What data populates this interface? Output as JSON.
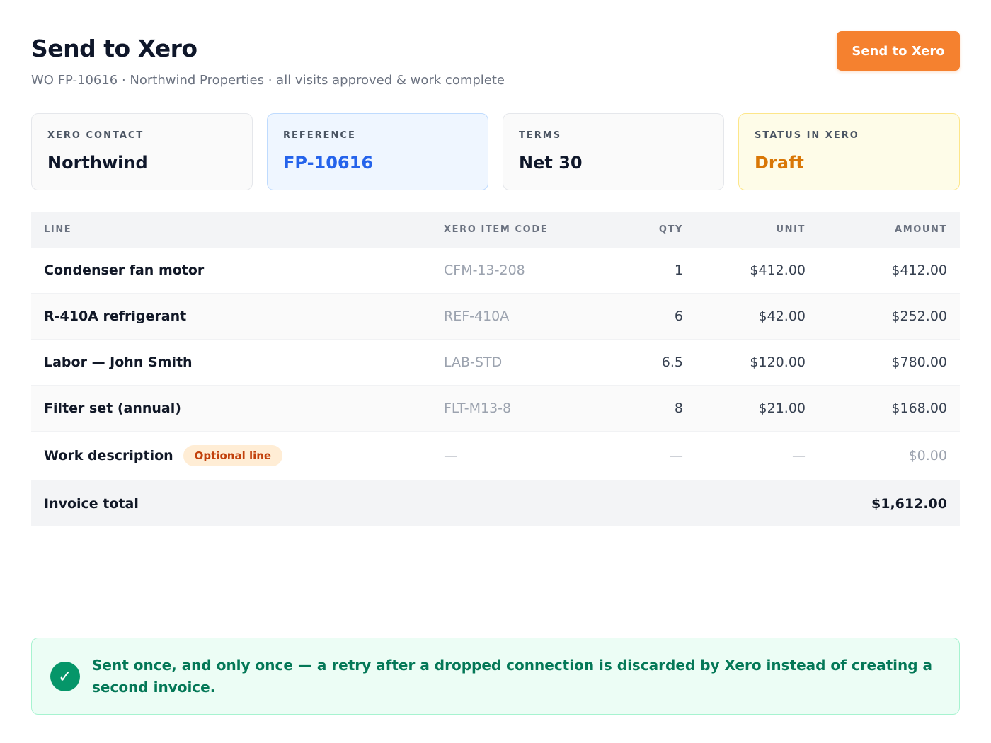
{
  "header": {
    "title": "Send to Xero",
    "subtitle": "WO FP-10616 · Northwind Properties · all visits approved & work complete",
    "send_label": "Send to Xero"
  },
  "cards": {
    "contact": {
      "label": "XERO CONTACT",
      "value": "Northwind"
    },
    "reference": {
      "label": "REFERENCE",
      "value": "FP-10616"
    },
    "terms": {
      "label": "TERMS",
      "value": "Net 30"
    },
    "status": {
      "label": "STATUS IN XERO",
      "value": "Draft"
    }
  },
  "table": {
    "headers": {
      "line": "LINE",
      "code": "XERO ITEM CODE",
      "qty": "QTY",
      "unit": "UNIT",
      "amount": "AMOUNT"
    },
    "rows": [
      {
        "line": "Condenser fan motor",
        "code": "CFM-13-208",
        "qty": "1",
        "unit": "$412.00",
        "amount": "$412.00"
      },
      {
        "line": "R-410A refrigerant",
        "code": "REF-410A",
        "qty": "6",
        "unit": "$42.00",
        "amount": "$252.00"
      },
      {
        "line": "Labor — John Smith",
        "code": "LAB-STD",
        "qty": "6.5",
        "unit": "$120.00",
        "amount": "$780.00"
      },
      {
        "line": "Filter set (annual)",
        "code": "FLT-M13-8",
        "qty": "8",
        "unit": "$21.00",
        "amount": "$168.00"
      },
      {
        "line": "Work description",
        "badge": "Optional line",
        "code": "—",
        "qty": "—",
        "unit": "—",
        "amount": "$0.00"
      }
    ],
    "total_label": "Invoice total",
    "total_value": "$1,612.00"
  },
  "notice": {
    "icon": "check-icon",
    "text": "Sent once, and only once — a retry after a dropped connection is discarded by Xero instead of creating a second invoice.",
    "color": "#059669"
  },
  "colors": {
    "accent": "#f5812f",
    "reference": "#2563eb",
    "status": "#d97706",
    "success": "#059669"
  }
}
